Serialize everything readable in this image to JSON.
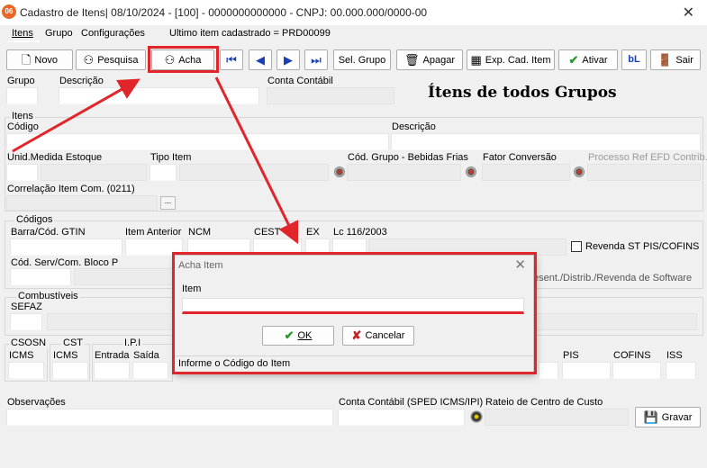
{
  "window": {
    "title": "Cadastro de Itens| 08/10/2024 - [100] - 0000000000000 - CNPJ: 00.000.000/0000-00",
    "app_icon": "06",
    "close": "✕"
  },
  "menu": {
    "items": [
      "Itens",
      "Grupo",
      "Configurações"
    ],
    "last_item_text": "Ultimo item cadastrado = PRD00099"
  },
  "toolbar": {
    "novo": "Novo",
    "pesquisa": "Pesquisa",
    "acha": "Acha",
    "sel_grupo": "Sel. Grupo",
    "apagar": "Apagar",
    "exp_cad_item": "Exp. Cad. Item",
    "ativar": "Ativar",
    "sair": "Sair"
  },
  "header_fields": {
    "grupo_label": "Grupo",
    "descricao_label": "Descrição",
    "conta_contabil_label": "Conta Contábil",
    "big_title": "Ítens de todos Grupos"
  },
  "itens_group": {
    "title": "Itens",
    "codigo_label": "Código",
    "descricao_label": "Descrição",
    "unid_label": "Unid.Medida Estoque",
    "tipo_item_label": "Tipo Item",
    "cod_grupo_label": "Cód. Grupo - Bebidas Frias",
    "fator_conversao_label": "Fator Conversão",
    "processo_ref_label": "Processo Ref EFD Contrib.",
    "correlacao_label": "Correlação Item Com. (0211)",
    "dots": "..."
  },
  "codigos_group": {
    "title": "Códigos",
    "barra_label": "Barra/Cód. GTIN",
    "item_anterior_label": "Item Anterior",
    "ncm_label": "NCM",
    "cest_label": "CEST",
    "ex_label": "EX",
    "lc_label": "Lc 116/2003",
    "revenda_label": "Revenda ST PIS/COFINS",
    "cod_serv_label": "Cód. Serv/Com. Bloco P",
    "revenda_software_label": "esent./Distrib./Revenda de Software"
  },
  "combustiveis_group": {
    "title": "Combustíveis",
    "sefaz_label": "SEFAZ"
  },
  "tax_groups": {
    "csosn_title": "CSOSN",
    "cst_title": "CST",
    "ipi_title": "I.P.I",
    "icms1_label": "ICMS",
    "icms2_label": "ICMS",
    "entrada_label": "Entrada",
    "saida_label": "Saída",
    "pis_label": "PIS",
    "cofins_label": "COFINS",
    "iss_label": "ISS"
  },
  "footer_fields": {
    "observacoes_label": "Observações",
    "conta_sped_label": "Conta Contábil (SPED ICMS/IPI)",
    "rateio_label": "Rateio de Centro de Custo",
    "gravar": "Gravar"
  },
  "dialog": {
    "title": "Acha Item",
    "close": "✕",
    "item_label": "Item",
    "item_value": "",
    "ok": "OK",
    "cancelar": "Cancelar",
    "status": "Informe o Código do Item"
  },
  "colors": {
    "highlight": "#e0262b",
    "app_icon": "#e8682a"
  }
}
